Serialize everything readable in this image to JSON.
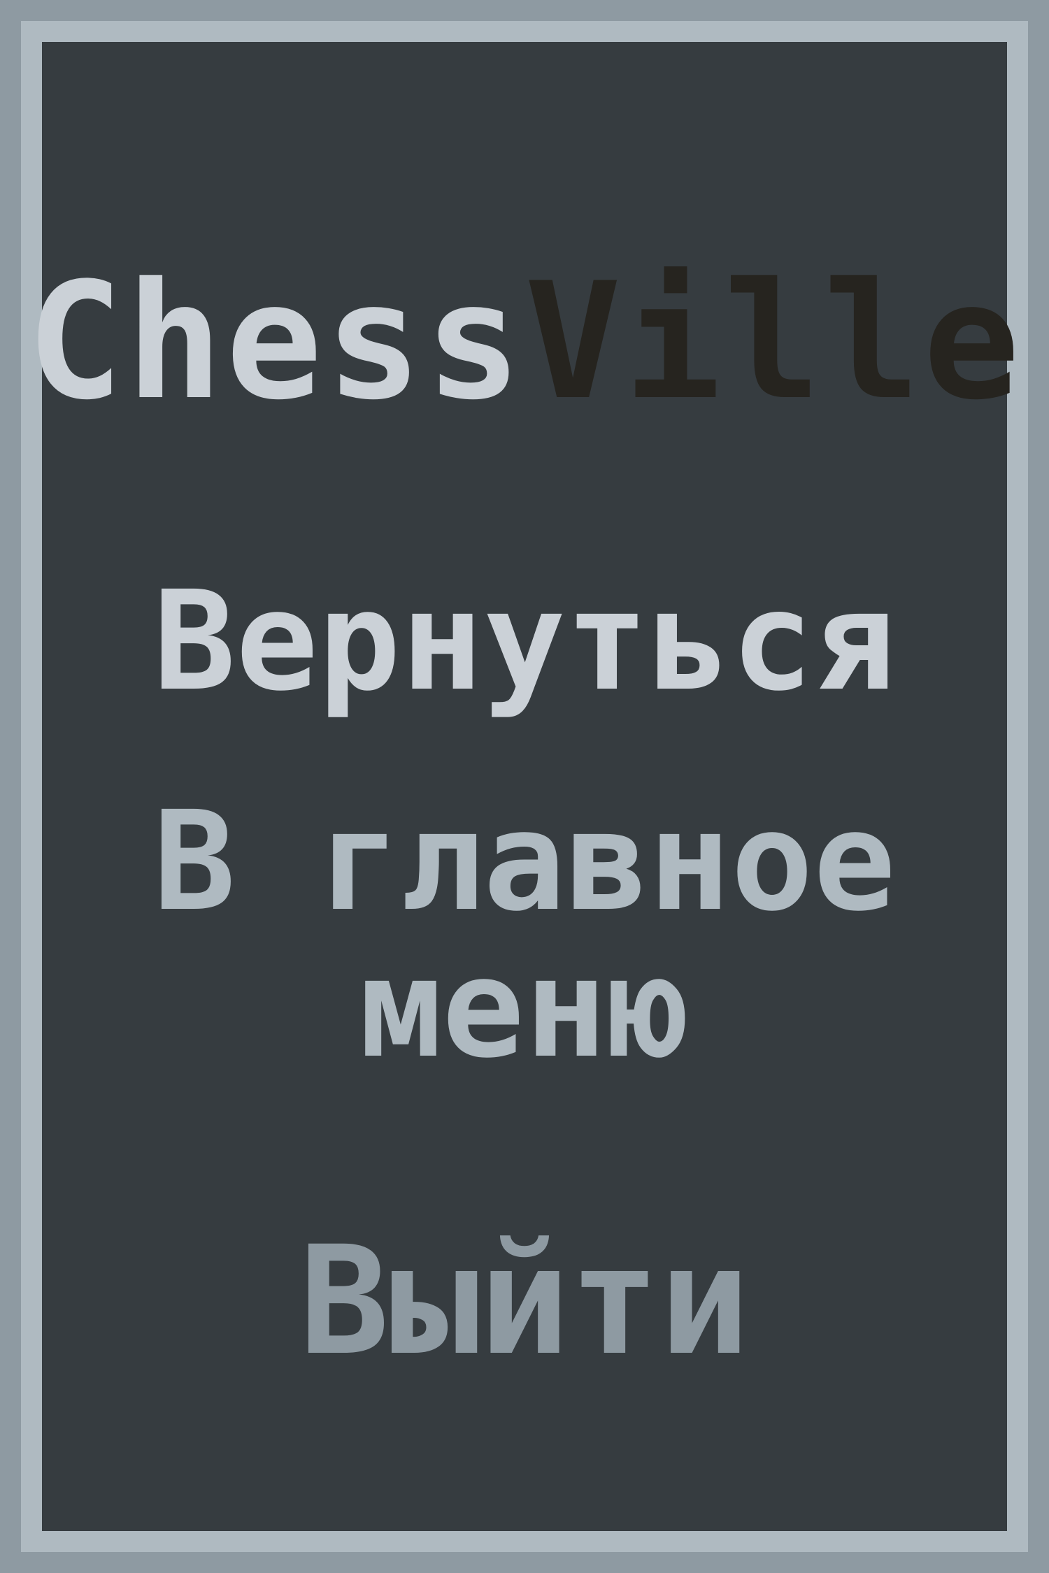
{
  "title": {
    "part1": "Chess",
    "part2": "Ville"
  },
  "menu": {
    "resume_label": "Вернуться",
    "main_menu_line1": "В главное",
    "main_menu_line2": "меню",
    "exit_label": "Выйти"
  },
  "colors": {
    "outer_border": "#8e9aa2",
    "inner_border": "#afbac1",
    "panel": "#363c40",
    "text_light": "#cbd1d7",
    "text_mid": "#afbac1",
    "text_dark": "#8e9aa2",
    "title_accent": "#26241f"
  }
}
